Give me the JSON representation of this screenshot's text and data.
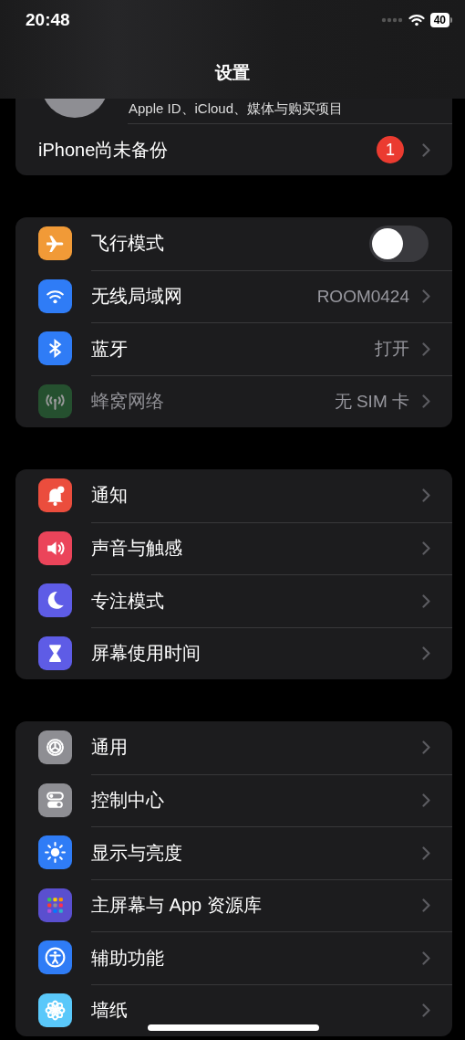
{
  "status_bar": {
    "time": "20:48",
    "battery": "40"
  },
  "nav": {
    "title": "设置"
  },
  "account": {
    "subtitle": "Apple ID、iCloud、媒体与购买项目",
    "backup": {
      "label": "iPhone尚未备份",
      "badge": "1"
    }
  },
  "sections": [
    {
      "rows": [
        {
          "kind": "toggle",
          "label": "飞行模式",
          "on": false,
          "disabled": false
        },
        {
          "kind": "link",
          "label": "无线局域网",
          "value": "ROOM0424",
          "disabled": false
        },
        {
          "kind": "link",
          "label": "蓝牙",
          "value": "打开",
          "disabled": false
        },
        {
          "kind": "link",
          "label": "蜂窝网络",
          "value": "无 SIM 卡",
          "disabled": true
        }
      ]
    },
    {
      "rows": [
        {
          "kind": "link",
          "label": "通知",
          "disabled": false
        },
        {
          "kind": "link",
          "label": "声音与触感",
          "disabled": false
        },
        {
          "kind": "link",
          "label": "专注模式",
          "disabled": false
        },
        {
          "kind": "link",
          "label": "屏幕使用时间",
          "disabled": false
        }
      ]
    },
    {
      "rows": [
        {
          "kind": "link",
          "label": "通用",
          "disabled": false
        },
        {
          "kind": "link",
          "label": "控制中心",
          "disabled": false
        },
        {
          "kind": "link",
          "label": "显示与亮度",
          "disabled": false
        },
        {
          "kind": "link",
          "label": "主屏幕与 App 资源库",
          "disabled": false
        },
        {
          "kind": "link",
          "label": "辅助功能",
          "disabled": false
        },
        {
          "kind": "link",
          "label": "墙纸",
          "disabled": false
        }
      ]
    }
  ]
}
